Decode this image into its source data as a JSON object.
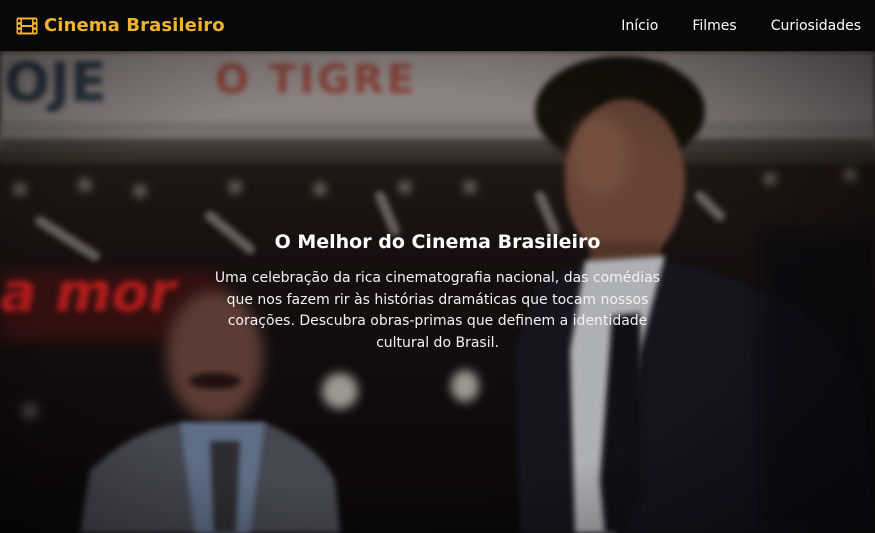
{
  "navbar": {
    "brand": {
      "icon": "film-icon",
      "title": "Cinema Brasileiro"
    },
    "links": [
      {
        "label": "Início"
      },
      {
        "label": "Filmes"
      },
      {
        "label": "Curiosidades"
      }
    ]
  },
  "hero": {
    "background": "film-still-photo",
    "title": "O Melhor do Cinema Brasileiro",
    "description": "Uma celebração da rica cinematografia nacional, das comédias que nos fazem rir às histórias dramáticas que tocam nossos corações. Descubra obras-primas que definem a identidade cultural do Brasil.",
    "background_sign_text": [
      "OJE",
      "O TIGRE",
      "a mor"
    ]
  },
  "colors": {
    "brand": "#f0b429",
    "navbar_bg": "#080808",
    "text": "#ffffff"
  }
}
